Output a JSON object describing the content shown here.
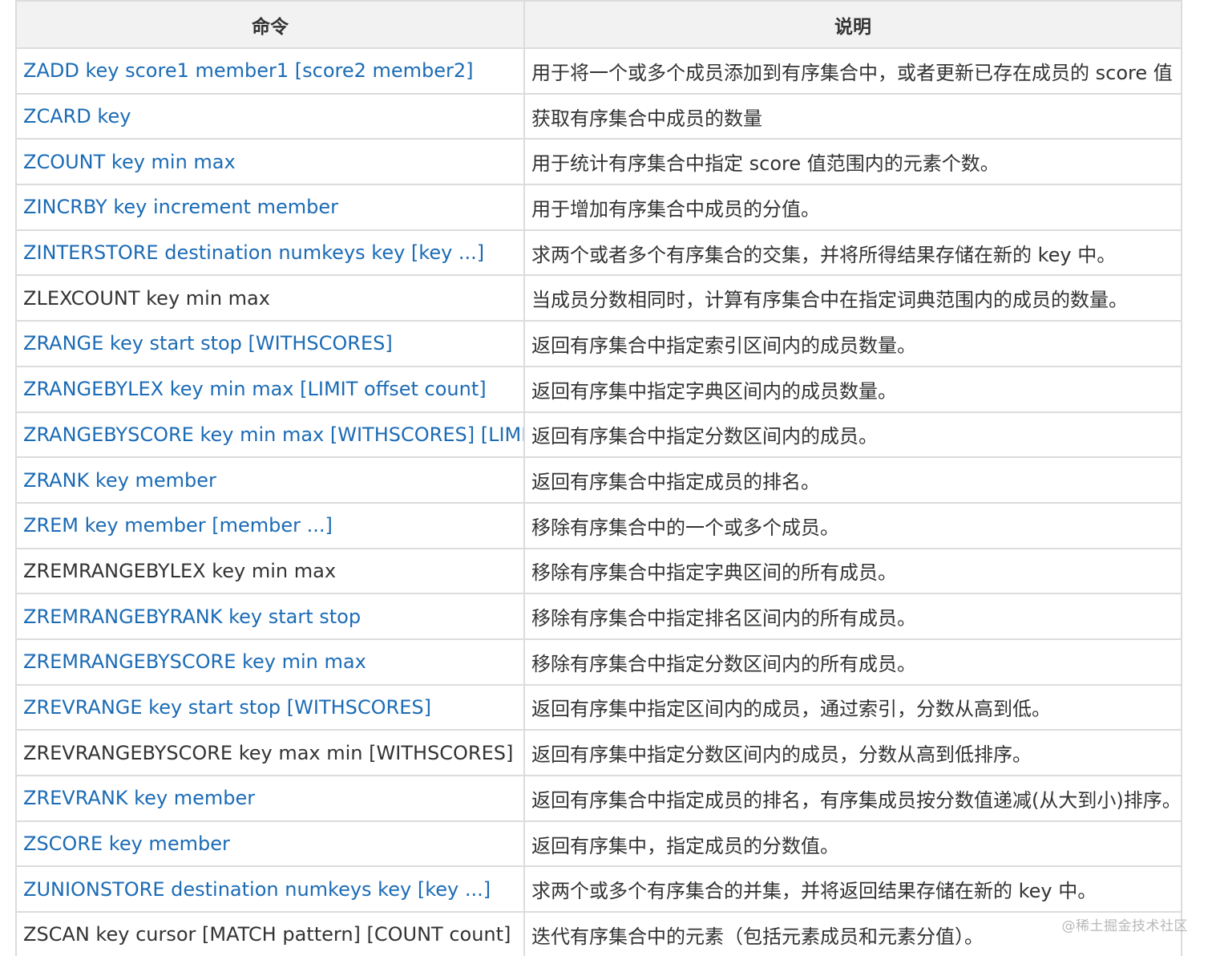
{
  "table": {
    "headers": [
      "命令",
      "说明"
    ],
    "rows": [
      {
        "command": "ZADD key score1 member1 [score2 member2]",
        "linked": true,
        "description": "用于将一个或多个成员添加到有序集合中，或者更新已存在成员的 score 值"
      },
      {
        "command": "ZCARD key",
        "linked": true,
        "description": "获取有序集合中成员的数量"
      },
      {
        "command": "ZCOUNT key min max",
        "linked": true,
        "description": "用于统计有序集合中指定 score 值范围内的元素个数。"
      },
      {
        "command": "ZINCRBY key increment member",
        "linked": true,
        "description": "用于增加有序集合中成员的分值。"
      },
      {
        "command": "ZINTERSTORE destination numkeys key [key ...]",
        "linked": true,
        "description": "求两个或者多个有序集合的交集，并将所得结果存储在新的 key 中。"
      },
      {
        "command": "ZLEXCOUNT key min max",
        "linked": false,
        "description": "当成员分数相同时，计算有序集合中在指定词典范围内的成员的数量。"
      },
      {
        "command": "ZRANGE key start stop [WITHSCORES]",
        "linked": true,
        "description": "返回有序集合中指定索引区间内的成员数量。"
      },
      {
        "command": "ZRANGEBYLEX key min max [LIMIT offset count]",
        "linked": true,
        "description": "返回有序集中指定字典区间内的成员数量。"
      },
      {
        "command": "ZRANGEBYSCORE key min max [WITHSCORES] [LIMIT]",
        "linked": true,
        "description": "返回有序集合中指定分数区间内的成员。"
      },
      {
        "command": "ZRANK key member",
        "linked": true,
        "description": "返回有序集合中指定成员的排名。"
      },
      {
        "command": "ZREM key member [member ...]",
        "linked": true,
        "description": "移除有序集合中的一个或多个成员。"
      },
      {
        "command": "ZREMRANGEBYLEX key min max",
        "linked": false,
        "description": "移除有序集合中指定字典区间的所有成员。"
      },
      {
        "command": "ZREMRANGEBYRANK key start stop",
        "linked": true,
        "description": "移除有序集合中指定排名区间内的所有成员。"
      },
      {
        "command": "ZREMRANGEBYSCORE key min max",
        "linked": true,
        "description": "移除有序集合中指定分数区间内的所有成员。"
      },
      {
        "command": "ZREVRANGE key start stop [WITHSCORES]",
        "linked": true,
        "description": "返回有序集中指定区间内的成员，通过索引，分数从高到低。"
      },
      {
        "command": "ZREVRANGEBYSCORE key max min [WITHSCORES]",
        "linked": false,
        "description": "返回有序集中指定分数区间内的成员，分数从高到低排序。"
      },
      {
        "command": "ZREVRANK key member",
        "linked": true,
        "description": "返回有序集合中指定成员的排名，有序集成员按分数值递减(从大到小)排序。"
      },
      {
        "command": "ZSCORE key member",
        "linked": true,
        "description": "返回有序集中，指定成员的分数值。"
      },
      {
        "command": "ZUNIONSTORE destination numkeys key [key ...]",
        "linked": true,
        "description": "求两个或多个有序集合的并集，并将返回结果存储在新的 key 中。"
      },
      {
        "command": "ZSCAN key cursor [MATCH pattern] [COUNT count]",
        "linked": false,
        "description": "迭代有序集合中的元素（包括元素成员和元素分值）。"
      }
    ]
  },
  "colors": {
    "link": "#1b6bb5",
    "text": "#333333",
    "header_bg": "#f2f2f2",
    "border": "#dcdcdc"
  },
  "watermark": "@稀土掘金技术社区"
}
